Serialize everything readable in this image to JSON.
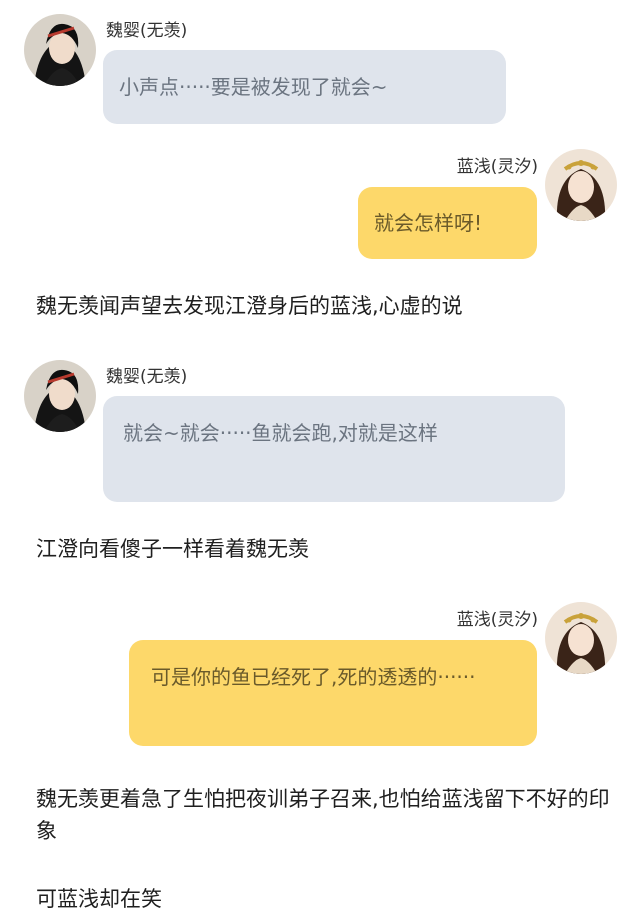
{
  "chat": {
    "wei_name": "魏婴(无羡)",
    "lan_name": "蓝浅(灵汐)",
    "msg1": "小声点·····要是被发现了就会~",
    "msg2": "就会怎样呀!",
    "narr1": "魏无羡闻声望去发现江澄身后的蓝浅,心虚的说",
    "msg3": "就会~就会·····鱼就会跑,对就是这样",
    "narr2": "江澄向看傻子一样看着魏无羡",
    "msg4": "可是你的鱼已经死了,死的透透的······",
    "narr3": "魏无羡更着急了生怕把夜训弟子召来,也怕给蓝浅留下不好的印象",
    "narr4": "可蓝浅却在笑"
  },
  "colors": {
    "left_bubble": "#dfe4ec",
    "right_bubble": "#fdd86a"
  },
  "icons": {
    "wei_avatar": "male-character-avatar",
    "lan_avatar": "female-character-avatar"
  }
}
